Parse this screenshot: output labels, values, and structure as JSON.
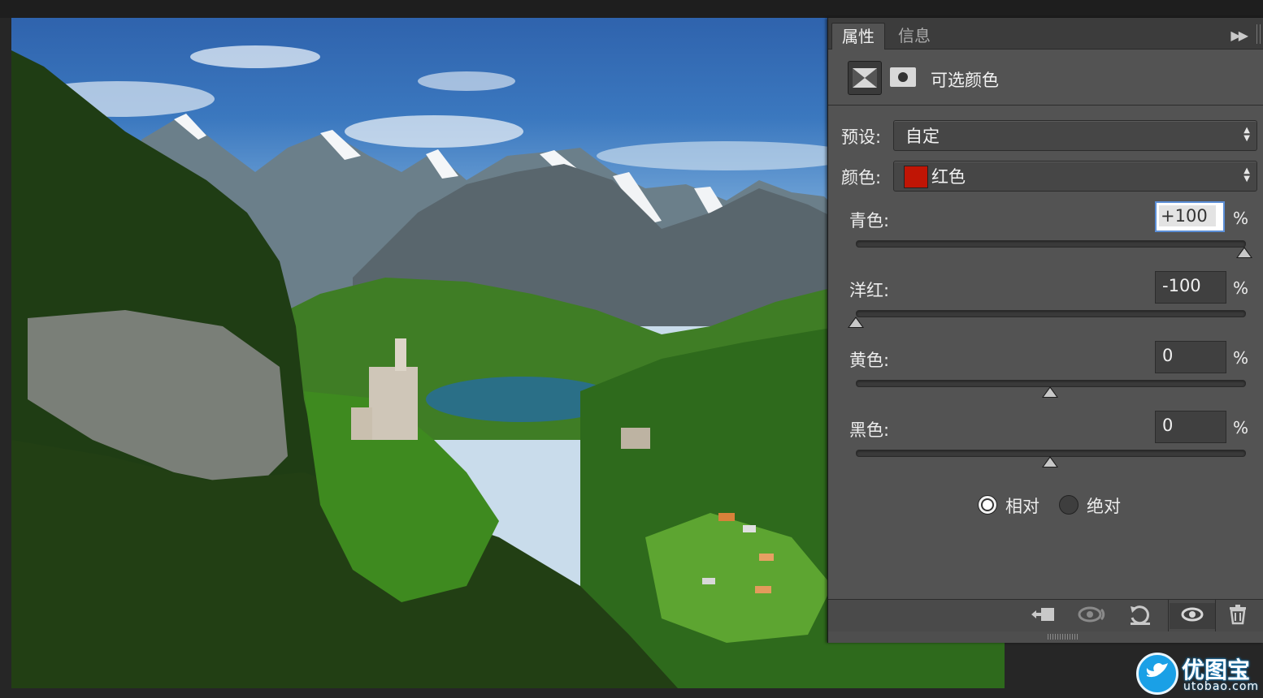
{
  "panel": {
    "tabs": [
      {
        "label": "属性",
        "active": true
      },
      {
        "label": "信息",
        "active": false
      }
    ],
    "menu_icon": "double-chevron-right-icon",
    "adjustment_title": "可选颜色",
    "preset_label": "预设:",
    "preset_value": "自定",
    "color_label": "颜色:",
    "color_value": "红色",
    "color_swatch": "#c01505",
    "sliders": [
      {
        "label": "青色:",
        "value": "+100",
        "unit": "%",
        "level": 1.0,
        "focused": true
      },
      {
        "label": "洋红:",
        "value": "-100",
        "unit": "%",
        "level": 0.0,
        "focused": false
      },
      {
        "label": "黄色:",
        "value": "0",
        "unit": "%",
        "level": 0.5,
        "focused": false
      },
      {
        "label": "黑色:",
        "value": "0",
        "unit": "%",
        "level": 0.5,
        "focused": false
      }
    ],
    "method": {
      "relative_label": "相对",
      "absolute_label": "绝对",
      "selected": "relative"
    },
    "footer_icons": [
      "clip-to-layer-icon",
      "view-previous-state-icon",
      "reset-icon",
      "visibility-eye-icon",
      "trash-icon"
    ]
  },
  "watermark": {
    "text": "优图宝",
    "url": "utobao.com"
  }
}
